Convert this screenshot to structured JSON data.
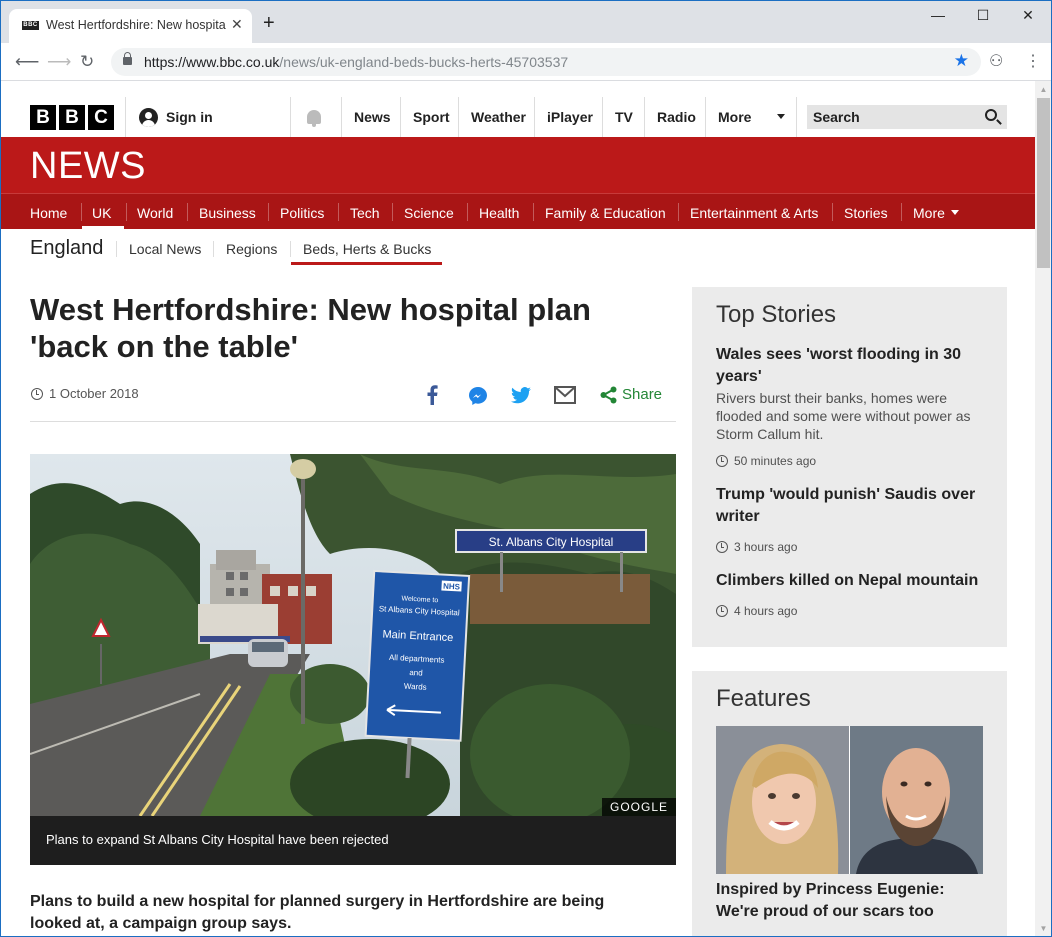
{
  "browser": {
    "tab_title": "West Hertfordshire: New hospital plan 'back on the table'",
    "tab_favicon_text": "BBC",
    "new_tab": "+",
    "window_controls": {
      "minimize": "—",
      "maximize": "☐",
      "close": "✕"
    },
    "url_host": "https://www.bbc.co.uk",
    "url_path": "/news/uk-england-beds-bucks-herts-45703537",
    "icons": [
      "back-icon",
      "forward-icon",
      "reload-icon",
      "lock-icon",
      "star-icon",
      "extension-icon",
      "menu-icon"
    ]
  },
  "bbc_nav": {
    "logo": [
      "B",
      "B",
      "C"
    ],
    "sign_in": "Sign in",
    "links": [
      "News",
      "Sport",
      "Weather",
      "iPlayer",
      "TV",
      "Radio",
      "More"
    ],
    "search_placeholder": "Search"
  },
  "news": {
    "banner": "NEWS",
    "nav": [
      "Home",
      "UK",
      "World",
      "Business",
      "Politics",
      "Tech",
      "Science",
      "Health",
      "Family & Education",
      "Entertainment & Arts",
      "Stories",
      "More"
    ],
    "active_nav": "UK",
    "brand_color": "#bb1919"
  },
  "subnav": {
    "title": "England",
    "links": [
      "Local News",
      "Regions",
      "Beds, Herts & Bucks"
    ],
    "active": "Beds, Herts & Bucks"
  },
  "article": {
    "headline": "West Hertfordshire: New hospital plan 'back on the table'",
    "date": "1 October 2018",
    "share_label": "Share",
    "share_icons": [
      "facebook-icon",
      "messenger-icon",
      "twitter-icon",
      "email-icon",
      "share-icon"
    ],
    "image_credit": "GOOGLE",
    "image_sign_top": "St. Albans City Hospital",
    "image_sign_main": [
      "Welcome to",
      "St Albans City Hospital",
      "Main Entrance",
      "All departments",
      "and",
      "Wards"
    ],
    "image_sign_nhs": "NHS",
    "caption": "Plans to expand St Albans City Hospital have been rejected",
    "lede": "Plans to build a new hospital for planned surgery in Hertfordshire are being looked at, a campaign group says."
  },
  "top_stories": {
    "title": "Top Stories",
    "items": [
      {
        "headline": "Wales sees 'worst flooding in 30 years'",
        "summary": "Rivers burst their banks, homes were flooded and some were without power as Storm Callum hit.",
        "time": "50 minutes ago"
      },
      {
        "headline": "Trump 'would punish' Saudis over writer",
        "time": "3 hours ago"
      },
      {
        "headline": "Climbers killed on Nepal mountain",
        "time": "4 hours ago"
      }
    ]
  },
  "features": {
    "title": "Features",
    "headline": "Inspired by Princess Eugenie: We're proud of our scars too"
  }
}
